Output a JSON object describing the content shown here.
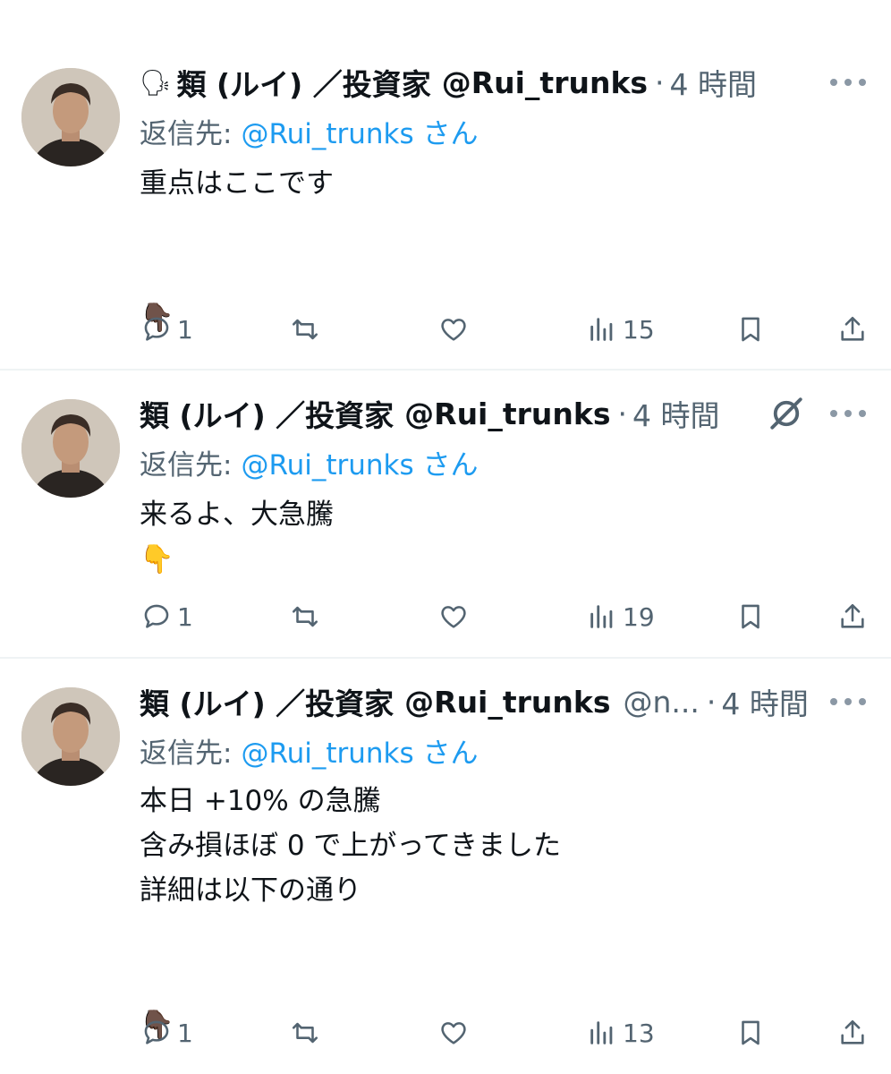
{
  "tweets": [
    {
      "status_emoji": "🗣",
      "name": "類 (ルイ) ／投資家",
      "handle": "@Rui_trunks",
      "extra": "",
      "separator": "·",
      "time": "4 時間",
      "reply_prefix": "返信先:",
      "reply_handle": "@Rui_trunks さん",
      "body": "重点はここです\n\n\n👇🏿",
      "counts": {
        "replies": "1",
        "retweets": "",
        "likes": "",
        "views": "15"
      }
    },
    {
      "status_emoji": "",
      "name": "類 (ルイ) ／投資家",
      "handle": "@Rui_trunks",
      "extra": "",
      "separator": "·",
      "time": "4 時間",
      "reply_prefix": "返信先:",
      "reply_handle": "@Rui_trunks さん",
      "body": "来るよ、大急騰\n👇",
      "counts": {
        "replies": "1",
        "retweets": "",
        "likes": "",
        "views": "19"
      }
    },
    {
      "status_emoji": "",
      "name": "類 (ルイ) ／投資家",
      "handle": "@Rui_trunks",
      "extra": "@n...",
      "separator": "·",
      "time": "4 時間",
      "reply_prefix": "返信先:",
      "reply_handle": "@Rui_trunks さん",
      "body": "本日 +10% の急騰\n含み損ほぼ 0 で上がってきました\n詳細は以下の通り\n\n\n👇🏿",
      "counts": {
        "replies": "1",
        "retweets": "",
        "likes": "",
        "views": "13"
      }
    }
  ],
  "icons": {
    "reply": "speech-bubble-icon",
    "retweet": "retweet-icon",
    "like": "heart-icon",
    "views": "bar-chart-icon",
    "bookmark": "bookmark-icon",
    "share": "share-icon",
    "more": "more-dots-icon",
    "grok": "grok-icon"
  },
  "colors": {
    "text": "#0f1419",
    "secondary": "#536471",
    "link": "#1d9bf0",
    "divider": "#eff3f4"
  }
}
